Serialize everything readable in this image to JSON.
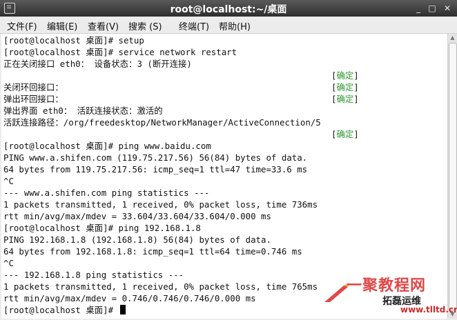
{
  "window": {
    "title": "root@localhost:~/桌面",
    "controls": {
      "minimize": "_",
      "maximize": "□",
      "close": "✕"
    }
  },
  "menu": [
    "文件(F)",
    "编辑(E)",
    "查看(V)",
    "搜索 (S)",
    "终端(T)",
    "帮助(H)"
  ],
  "terminal": {
    "lines": [
      "[root@localhost 桌面]# setup",
      "[root@localhost 桌面]# service network restart",
      "正在关闭接口 eth0： 设备状态：3 (断开连接)",
      "",
      "关闭环回接口：",
      "弹出环回接口：",
      "弹出界面 eth0： 活跃连接状态：激活的",
      "活跃连接路径：/org/freedesktop/NetworkManager/ActiveConnection/5",
      "",
      "[root@localhost 桌面]# ping www.baidu.com",
      "PING www.a.shifen.com (119.75.217.56) 56(84) bytes of data.",
      "64 bytes from 119.75.217.56: icmp_seq=1 ttl=47 time=33.6 ms",
      "^C",
      "--- www.a.shifen.com ping statistics ---",
      "1 packets transmitted, 1 received, 0% packet loss, time 736ms",
      "rtt min/avg/max/mdev = 33.604/33.604/33.604/0.000 ms",
      "[root@localhost 桌面]# ping 192.168.1.8",
      "PING 192.168.1.8 (192.168.1.8) 56(84) bytes of data.",
      "64 bytes from 192.168.1.8: icmp_seq=1 ttl=64 time=0.746 ms",
      "^C",
      "--- 192.168.1.8 ping statistics ---",
      "1 packets transmitted, 1 received, 0% packet loss, time 765ms",
      "rtt min/avg/max/mdev = 0.746/0.746/0.746/0.000 ms",
      "[root@localhost 桌面]# "
    ],
    "ok_label": "确定",
    "ok_line_indexes": [
      3,
      4,
      5,
      8
    ]
  },
  "watermark": {
    "main": "一聚教程网",
    "sub": "拓磊运维",
    "url": "www.tlltd.cn"
  },
  "colors": {
    "ok_green": "#2f9a2f",
    "titlebar_dark": "#2e2e2e",
    "watermark_red": "#e04848"
  }
}
